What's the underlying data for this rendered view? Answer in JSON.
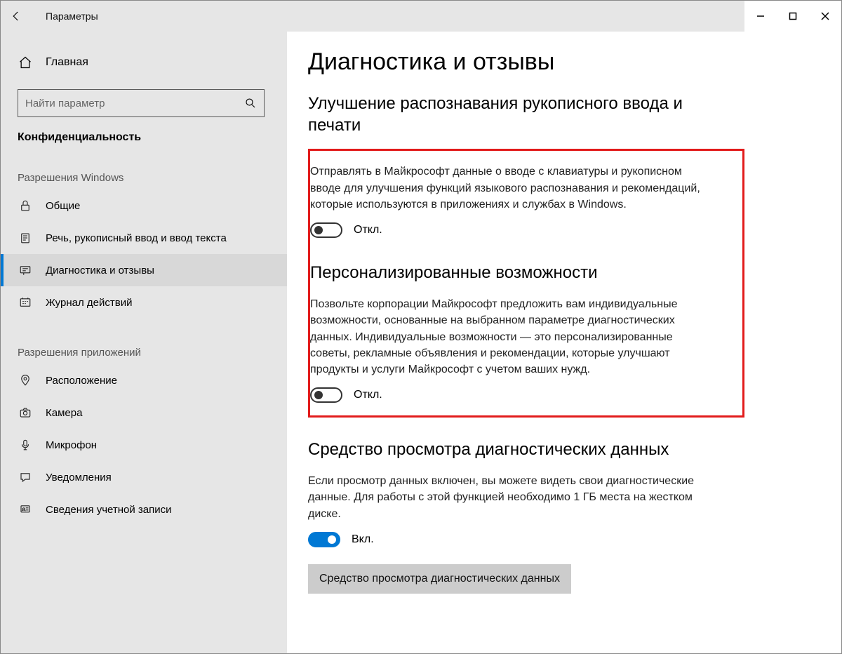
{
  "window": {
    "title": "Параметры"
  },
  "sidebar": {
    "home": "Главная",
    "search_placeholder": "Найти параметр",
    "category": "Конфиденциальность",
    "group1": "Разрешения Windows",
    "group2": "Разрешения приложений",
    "items1": [
      {
        "label": "Общие",
        "icon": "lock"
      },
      {
        "label": "Речь, рукописный ввод и ввод текста",
        "icon": "clipboard"
      },
      {
        "label": "Диагностика и отзывы",
        "icon": "feedback",
        "active": true
      },
      {
        "label": "Журнал действий",
        "icon": "history"
      }
    ],
    "items2": [
      {
        "label": "Расположение",
        "icon": "location"
      },
      {
        "label": "Камера",
        "icon": "camera"
      },
      {
        "label": "Микрофон",
        "icon": "mic"
      },
      {
        "label": "Уведомления",
        "icon": "notification"
      },
      {
        "label": "Сведения учетной записи",
        "icon": "account"
      }
    ]
  },
  "main": {
    "title": "Диагностика и отзывы",
    "section1": {
      "heading": "Улучшение распознавания рукописного ввода и печати",
      "desc": "Отправлять в Майкрософт данные о вводе с клавиатуры и рукописном вводе для улучшения функций языкового распознавания и рекомендаций, которые используются в приложениях и службах в Windows.",
      "toggle_state": "Откл."
    },
    "section2": {
      "heading": "Персонализированные возможности",
      "desc": "Позвольте корпорации Майкрософт предложить вам индивидуальные возможности, основанные на выбранном параметре диагностических данных. Индивидуальные возможности — это персонализированные советы, рекламные объявления и рекомендации, которые улучшают продукты и услуги Майкрософт с учетом ваших нужд.",
      "toggle_state": "Откл."
    },
    "section3": {
      "heading": "Средство просмотра диагностических данных",
      "desc": "Если просмотр данных включен, вы можете видеть свои диагностические данные. Для работы с этой функцией необходимо 1 ГБ места на жестком диске.",
      "toggle_state": "Вкл.",
      "button": "Средство просмотра диагностических данных"
    }
  }
}
